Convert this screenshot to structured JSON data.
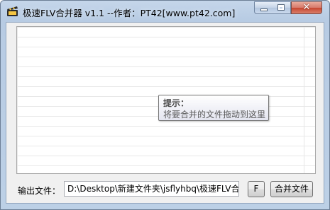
{
  "window": {
    "title": "极速FLV合并器 v1.1 --作者：PT42[www.pt42.com]",
    "controls": {
      "minimize": "minimize-icon",
      "maximize": "maximize-icon",
      "close_glyph": "✕"
    }
  },
  "drop_area": {
    "tooltip_title": "提示：",
    "tooltip_text": "将要合并的文件拖动到这里"
  },
  "output": {
    "label": "输出文件：",
    "path_value": "D:\\Desktop\\新建文件夹\\jsflyhbq\\极速FLV合"
  },
  "buttons": {
    "browse_label": "F",
    "merge_label": "合并文件"
  },
  "colors": {
    "titlebar": "#b9cde4",
    "close_button": "#c7452f",
    "client_bg": "#f0f0f0"
  }
}
